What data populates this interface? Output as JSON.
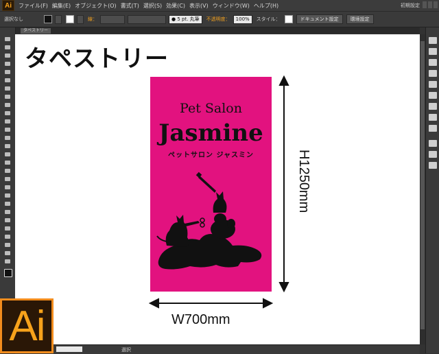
{
  "app": {
    "logo_text": "Ai",
    "workspace": "初期設定",
    "menu": [
      "ファイル(F)",
      "編集(E)",
      "オブジェクト(O)",
      "書式(T)",
      "選択(S)",
      "効果(C)",
      "表示(V)",
      "ウィンドウ(W)",
      "ヘルプ(H)"
    ]
  },
  "control_bar": {
    "selection_label": "選択なし",
    "stroke_label": "線：",
    "brush_value": "● 5 pt. 丸筆",
    "opacity_label": "不透明度：",
    "opacity_value": "100%",
    "style_label": "スタイル：",
    "doc_settings": "ドキュメント設定",
    "env_settings": "環境設定"
  },
  "status": {
    "tab_label": "タペストリー",
    "zoom": "",
    "state": "選択"
  },
  "artboard": {
    "heading": "タペストリー",
    "banner": {
      "line1": "Pet Salon",
      "line2": "Jasmine",
      "line3": "ペットサロン ジャスミン",
      "color": "#e2127f"
    },
    "width_label": "W700mm",
    "height_label": "H1250mm"
  },
  "colors": {
    "accent": "#f7a21b",
    "ui_bg": "#323232"
  }
}
